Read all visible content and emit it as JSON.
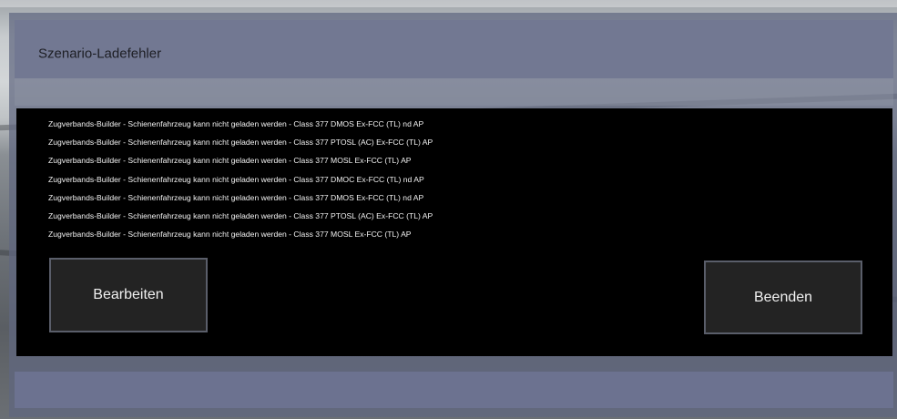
{
  "dialog": {
    "title": "Szenario-Ladefehler",
    "errors": [
      "Zugverbands-Builder - Schienenfahrzeug kann nicht geladen werden - Class 377 DMOS Ex-FCC (TL) nd AP",
      "Zugverbands-Builder - Schienenfahrzeug kann nicht geladen werden - Class 377 PTOSL (AC) Ex-FCC (TL) AP",
      "Zugverbands-Builder - Schienenfahrzeug kann nicht geladen werden - Class 377 MOSL Ex-FCC (TL) AP",
      "Zugverbands-Builder - Schienenfahrzeug kann nicht geladen werden - Class 377 DMOC Ex-FCC (TL) nd AP",
      "Zugverbands-Builder - Schienenfahrzeug kann nicht geladen werden - Class 377 DMOS Ex-FCC (TL) nd AP",
      "Zugverbands-Builder - Schienenfahrzeug kann nicht geladen werden - Class 377 PTOSL (AC) Ex-FCC (TL) AP",
      "Zugverbands-Builder - Schienenfahrzeug kann nicht geladen werden - Class 377 MOSL Ex-FCC (TL) AP"
    ],
    "buttons": {
      "edit_label": "Bearbeiten",
      "exit_label": "Beenden"
    }
  },
  "colors": {
    "dialog_bg": "#606680",
    "title_bar": "#727892",
    "content_bg": "#000000",
    "button_bg": "#232323",
    "button_border": "#5a5e6a"
  }
}
